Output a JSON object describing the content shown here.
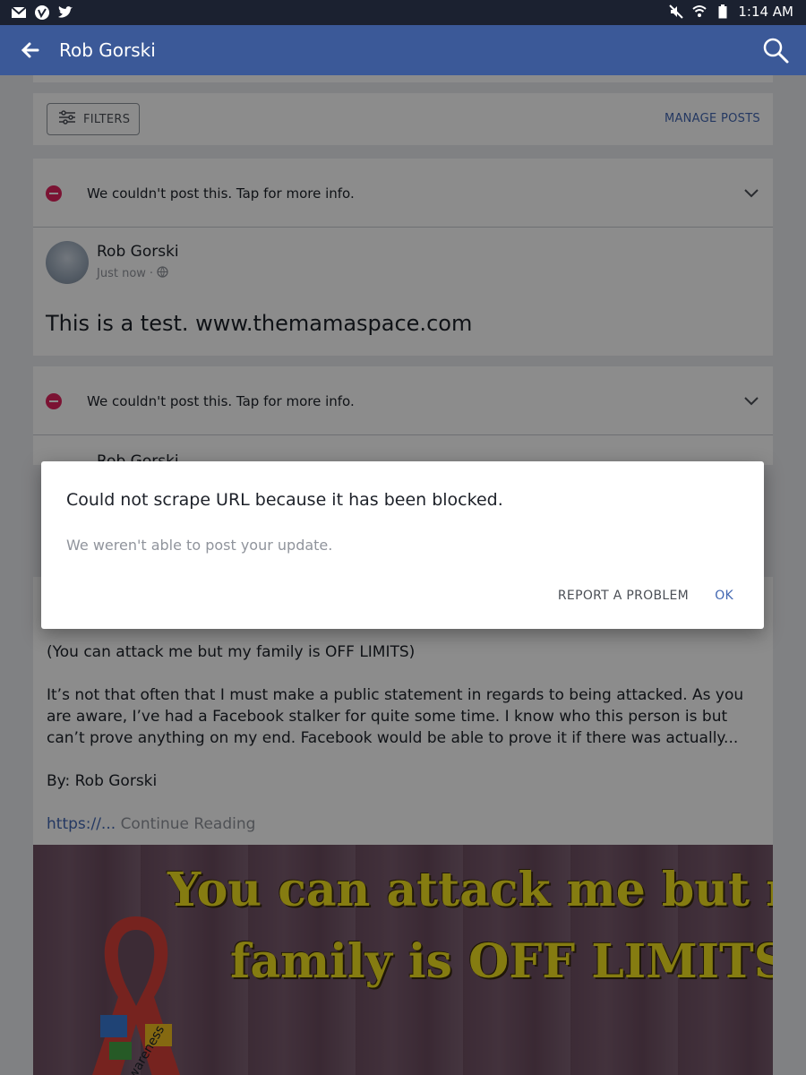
{
  "status_bar": {
    "time": "1:14 AM",
    "icons": [
      "mail-icon",
      "vimeo-icon",
      "twitter-icon",
      "mute-icon",
      "wifi-icon",
      "battery-icon"
    ]
  },
  "app_bar": {
    "title": "Rob Gorski",
    "back_icon": "back-arrow-icon",
    "search_icon": "search-icon",
    "color": "#3b5998"
  },
  "filters": {
    "filters_label": "FILTERS",
    "manage_posts_label": "MANAGE POSTS"
  },
  "failed_posts": [
    {
      "error_text": "We couldn't post this. Tap for more info.",
      "author": "Rob Gorski",
      "time": "Just now",
      "text": "This is a test. www.themamaspace.com"
    },
    {
      "error_text": "We couldn't post this. Tap for more info.",
      "author": "Rob Gorski"
    }
  ],
  "post": {
    "line1": "(You can attack me but my family is OFF LIMITS)",
    "paragraph": "It’s not that often that I must make a public statement in regards to being attacked. As you are aware, I’ve had a Facebook stalker for quite some time. I know who this person is but can’t prove anything on my end. Facebook would be able to prove it if there was actually...",
    "byline": "By: Rob Gorski",
    "link_text": "https://...",
    "continue_text": "Continue Reading",
    "image_text_line1": "You can attack me but my",
    "image_text_line2": "family is OFF LIMITS",
    "ribbon_text": "awareness"
  },
  "dialog": {
    "title": "Could not scrape URL because it has been blocked.",
    "message": "We weren't able to post your update.",
    "report_label": "REPORT A PROBLEM",
    "ok_label": "OK"
  },
  "colors": {
    "error": "#e0245e",
    "link": "#4267b2",
    "status_bar": "#1b2130"
  }
}
